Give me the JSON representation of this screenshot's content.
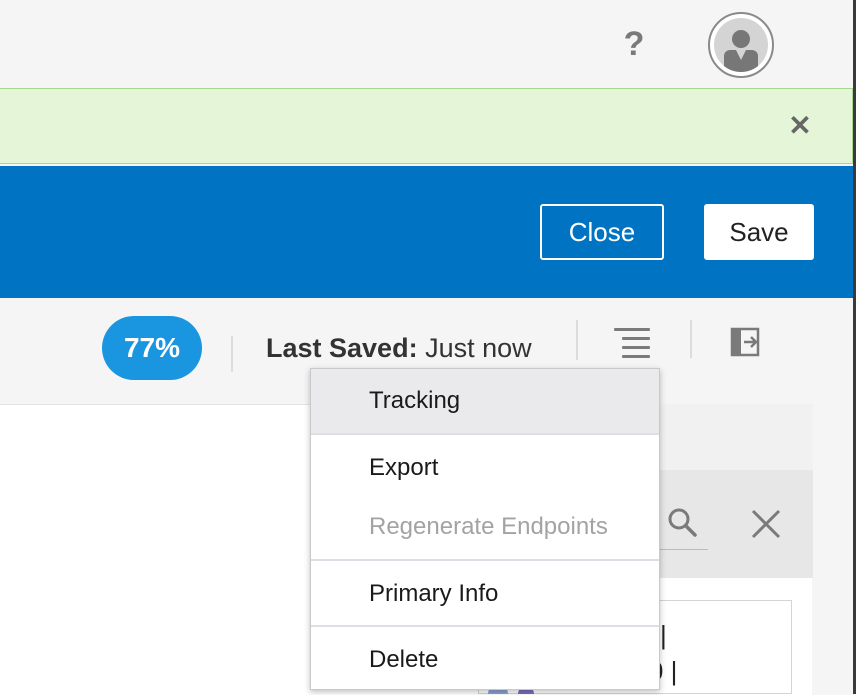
{
  "topbar": {
    "help_icon": "help-question-icon",
    "help_glyph": "?",
    "avatar_icon": "user-avatar-icon"
  },
  "notification": {
    "close_glyph": "✕"
  },
  "header": {
    "close_label": "Close",
    "save_label": "Save",
    "color": "#0074c3"
  },
  "toolbar": {
    "progress_label": "77%",
    "progress_value": 77,
    "last_saved_label": "Last Saved:",
    "last_saved_value": "Just now",
    "menu_icon": "hamburger-menu-icon",
    "exit_icon": "exit-panel-icon"
  },
  "dropdown": {
    "items": [
      {
        "label": "Tracking",
        "state": "hover"
      },
      {
        "label": "Export",
        "state": "normal"
      },
      {
        "label": "Regenerate Endpoints",
        "state": "disabled"
      },
      {
        "label": "Primary Info",
        "state": "normal"
      },
      {
        "label": "Delete",
        "state": "normal"
      }
    ]
  },
  "panel": {
    "card_line1": "|",
    "card_line2": "000 |",
    "search_icon": "search-icon",
    "clear_icon": "close-icon"
  }
}
